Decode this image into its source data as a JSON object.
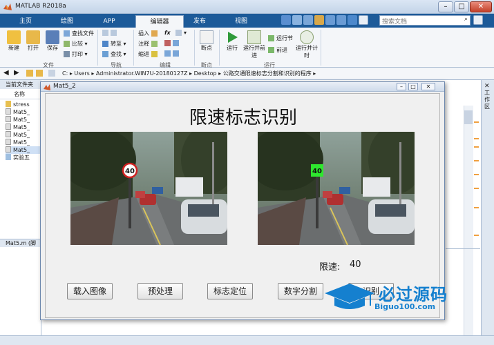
{
  "app": {
    "title": "MATLAB R2018a"
  },
  "tabs": [
    {
      "label": "主页"
    },
    {
      "label": "绘图"
    },
    {
      "label": "APP"
    },
    {
      "label": "编辑器"
    },
    {
      "label": "发布"
    },
    {
      "label": "视图"
    }
  ],
  "search": {
    "placeholder": "搜索文档"
  },
  "ribbon": {
    "file_group": {
      "new": "新建",
      "open": "打开",
      "save": "保存",
      "find_files": "查找文件",
      "compare": "比较",
      "print": "打印",
      "label": "文件"
    },
    "nav_group": {
      "goto": "转至",
      "find": "查找",
      "label": "导航"
    },
    "edit_group": {
      "insert": "插入",
      "comment": "注释",
      "indent": "缩进",
      "fx": "fx",
      "label": "编辑"
    },
    "breakpoint_group": {
      "breakpoints": "断点",
      "label": "断点"
    },
    "run_group": {
      "run": "运行",
      "run_advance": "运行并前进",
      "run_section": "运行节",
      "advance": "前进",
      "run_time": "运行并计时",
      "label": "运行"
    }
  },
  "address": {
    "path": "C: ▸ Users ▸ Administrator.WIN7U-20180127Z ▸ Desktop ▸ 公路交通限速标志分割和识别的程序 ▸"
  },
  "left_panel": {
    "header": "当前文件夹",
    "column": "名称",
    "items": [
      "stress",
      "Mat5_",
      "Mat5_",
      "Mat5_",
      "Mat5_",
      "Mat5_",
      "Mat5_",
      "实验五"
    ],
    "details": "Mat5.m (脚"
  },
  "right_panel": {
    "label": "工作区"
  },
  "figure": {
    "title": "Mat5_2",
    "heading": "限速标志识别",
    "speed_label": "限速:",
    "speed_value": "40",
    "sign_text": "40",
    "buttons": [
      "载入图像",
      "预处理",
      "标志定位",
      "数字分割",
      "识别"
    ]
  },
  "watermark": {
    "text": "必过源码",
    "url": "Biguo100.com"
  }
}
